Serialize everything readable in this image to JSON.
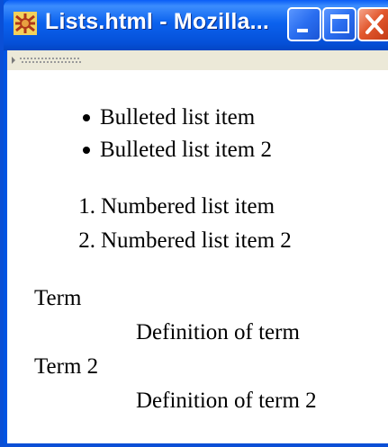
{
  "window": {
    "title": "Lists.html - Mozilla...",
    "icon": "mozilla-app-icon",
    "controls": [
      "minimize-icon",
      "maximize-icon",
      "close-icon"
    ]
  },
  "content": {
    "bulleted_list": [
      "Bulleted list item",
      "Bulleted list item 2"
    ],
    "numbered_list": [
      {
        "number": "1.",
        "text": "Numbered list item"
      },
      {
        "number": "2.",
        "text": "Numbered list item 2"
      }
    ],
    "definition_list": [
      {
        "term": "Term",
        "definition": "Definition of term"
      },
      {
        "term": "Term 2",
        "definition": "Definition of term 2"
      }
    ]
  }
}
